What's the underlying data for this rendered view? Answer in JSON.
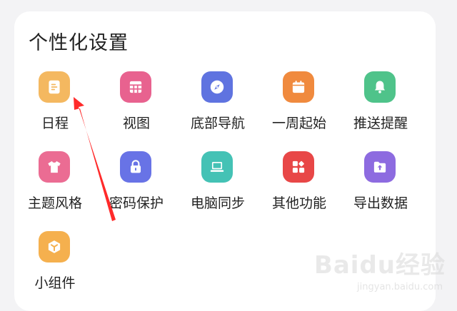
{
  "section": {
    "title": "个性化设置"
  },
  "items": [
    {
      "label": "日程",
      "icon": "schedule-icon",
      "color": "#f4b860"
    },
    {
      "label": "视图",
      "icon": "view-grid-icon",
      "color": "#e8628f"
    },
    {
      "label": "底部导航",
      "icon": "compass-icon",
      "color": "#5f73e0"
    },
    {
      "label": "一周起始",
      "icon": "calendar-icon",
      "color": "#f08a3e"
    },
    {
      "label": "推送提醒",
      "icon": "bell-icon",
      "color": "#4fc38a"
    },
    {
      "label": "主题风格",
      "icon": "tshirt-icon",
      "color": "#eb6c93"
    },
    {
      "label": "密码保护",
      "icon": "lock-icon",
      "color": "#6873e6"
    },
    {
      "label": "电脑同步",
      "icon": "laptop-icon",
      "color": "#44c2b5"
    },
    {
      "label": "其他功能",
      "icon": "apps-icon",
      "color": "#e84747"
    },
    {
      "label": "导出数据",
      "icon": "folder-upload-icon",
      "color": "#8d6be0"
    },
    {
      "label": "小组件",
      "icon": "widget-cube-icon",
      "color": "#f5b04e"
    }
  ],
  "annotation": {
    "arrow_color": "#ff2a2a"
  },
  "watermark": {
    "logo": "Baidu经验",
    "sub": "jingyan.baidu.com"
  }
}
